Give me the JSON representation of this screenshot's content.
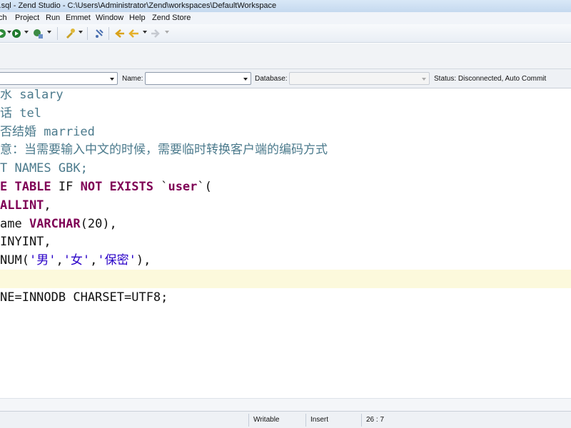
{
  "window": {
    "title": "st.sql - Zend Studio - C:\\Users\\Administrator\\Zend\\workspaces\\DefaultWorkspace"
  },
  "menu": {
    "items": [
      "ch",
      "Project",
      "Run",
      "Emmet",
      "Window",
      "Help",
      "Zend Store"
    ]
  },
  "toolbar": {
    "icons": [
      "run-icon",
      "debug-icon",
      "profile-icon",
      "tools-icon",
      "pin-icon",
      "back-icon",
      "forward-icon",
      "next-icon"
    ]
  },
  "connection": {
    "name_label": "Name:",
    "database_label": "Database:",
    "status": "Status: Disconnected, Auto Commit"
  },
  "editor": {
    "lines": [
      [
        {
          "t": "水 salary",
          "c": "cm"
        }
      ],
      [
        {
          "t": "话 tel",
          "c": "cm"
        }
      ],
      [
        {
          "t": "否结婚 married",
          "c": "cm"
        }
      ],
      [
        {
          "t": "意：当需要输入中文的时候，需要临时转换客户端的编码方式",
          "c": "cm"
        }
      ],
      [
        {
          "t": "T NAMES GBK;",
          "c": "cm"
        }
      ],
      [
        {
          "t": "E TABLE",
          "c": "kw"
        },
        {
          "t": " IF ",
          "c": "pl"
        },
        {
          "t": "NOT EXISTS",
          "c": "kw"
        },
        {
          "t": " `",
          "c": "pl"
        },
        {
          "t": "user",
          "c": "kw"
        },
        {
          "t": "`(",
          "c": "pl"
        }
      ],
      [
        {
          "t": "ALLINT",
          "c": "kw"
        },
        {
          "t": ",",
          "c": "pl"
        }
      ],
      [
        {
          "t": "ame ",
          "c": "pl"
        },
        {
          "t": "VARCHAR",
          "c": "kw"
        },
        {
          "t": "(20),",
          "c": "pl"
        }
      ],
      [
        {
          "t": "INYINT,",
          "c": "pl"
        }
      ],
      [
        {
          "t": "NUM(",
          "c": "pl"
        },
        {
          "t": "'男'",
          "c": "str"
        },
        {
          "t": ",",
          "c": "pl"
        },
        {
          "t": "'女'",
          "c": "str"
        },
        {
          "t": ",",
          "c": "pl"
        },
        {
          "t": "'保密'",
          "c": "str"
        },
        {
          "t": "),",
          "c": "pl"
        }
      ],
      [],
      [
        {
          "t": "NE=INNODB CHARSET=UTF8;",
          "c": "pl"
        }
      ]
    ],
    "current_line_index": 10
  },
  "status": {
    "writable": "Writable",
    "insert": "Insert",
    "position": "26 : 7"
  }
}
